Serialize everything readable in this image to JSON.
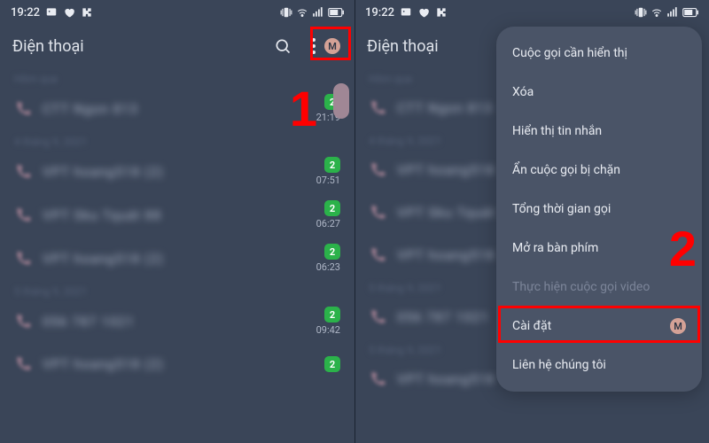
{
  "status": {
    "time": "19:22"
  },
  "header": {
    "title": "Điện thoại",
    "avatar_letter": "M"
  },
  "annotations": {
    "box1_label": "1",
    "box2_label": "2"
  },
  "left": {
    "sections": [
      {
        "label": "Hôm qua"
      },
      {
        "label": "4 tháng 9, 2021"
      },
      {
        "label": "5 tháng 9, 2021"
      }
    ],
    "rows": [
      {
        "name": "CTT Ngon 813",
        "badge": "2",
        "time": "21:19"
      },
      {
        "name": "VPT hoang518 (2)",
        "badge": "2",
        "time": "07:51"
      },
      {
        "name": "VPT Sku Tquát 88",
        "badge": "2",
        "time": "06:27"
      },
      {
        "name": "VPT hoang518 (2)",
        "badge": "2",
        "time": "06:23"
      },
      {
        "name": "056 787 1021",
        "badge": "2",
        "time": "09:42"
      },
      {
        "name": "VPT hoang518 (2)",
        "badge": "2",
        "time": ""
      }
    ]
  },
  "right": {
    "rows": [
      {
        "name": "CTT Ngon 813"
      },
      {
        "name": "VPT hoang518"
      },
      {
        "name": "VPT Sku Tquát"
      },
      {
        "name": "VPT hoang518"
      },
      {
        "name": "056 787 1021"
      },
      {
        "name": "5 tháng 9, 2021"
      },
      {
        "name": "VPT hoang518"
      }
    ]
  },
  "menu": {
    "items": [
      {
        "label": "Cuộc gọi cần hiển thị"
      },
      {
        "label": "Xóa"
      },
      {
        "label": "Hiển thị tin nhắn"
      },
      {
        "label": "Ẩn cuộc gọi bị chặn"
      },
      {
        "label": "Tổng thời gian gọi"
      },
      {
        "label": "Mở ra bàn phím"
      },
      {
        "label": "Thực hiện cuộc gọi video",
        "disabled": true
      },
      {
        "label": "Cài đặt",
        "avatar": "M"
      },
      {
        "label": "Liên hệ chúng tôi"
      }
    ]
  }
}
